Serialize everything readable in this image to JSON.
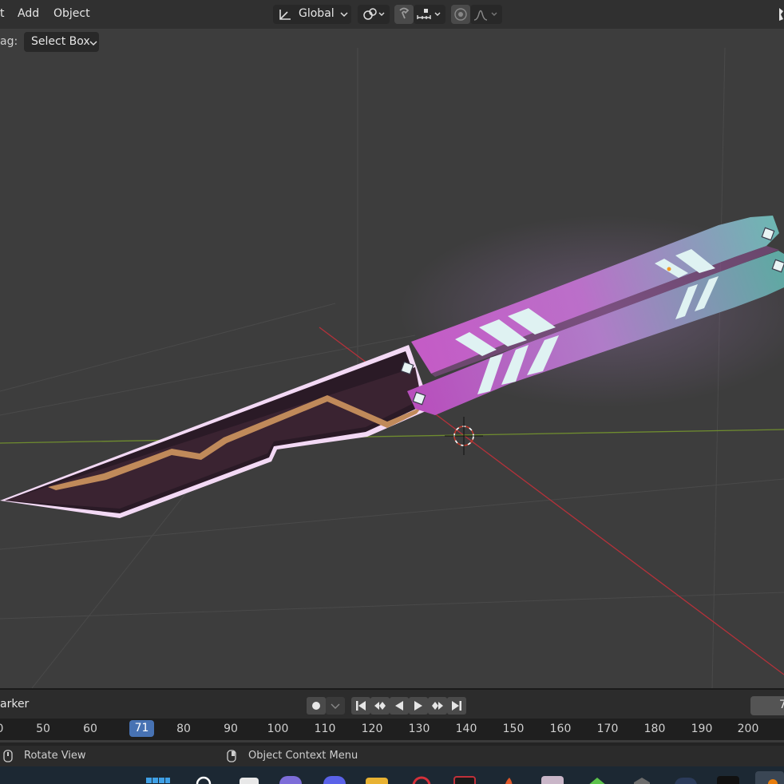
{
  "menu": {
    "select_partial": "t",
    "add": "Add",
    "object": "Object"
  },
  "toolbar": {
    "transform_orientation": "Global",
    "icons": [
      "orientation-axes-icon",
      "chevron-down-icon",
      "pivot-link-icon",
      "snap-magnet-icon",
      "snap-increment-icon",
      "proportional-edit-icon",
      "falloff-curve-icon"
    ]
  },
  "tool_options": {
    "drag_label": "ag:",
    "drag_value": "Select Box"
  },
  "timeline": {
    "marker_label": "arker",
    "current_frame": "71",
    "ticks": [
      "0",
      "50",
      "60",
      "80",
      "90",
      "100",
      "110",
      "120",
      "130",
      "140",
      "150",
      "160",
      "170",
      "180",
      "190",
      "200"
    ],
    "end_field_partial": "7"
  },
  "statusbar": {
    "left_hint": "Rotate View",
    "right_hint": "Object Context Menu"
  },
  "colors": {
    "accent_blue": "#4772b3",
    "viewport_bg": "#3d3d3d",
    "knife_magenta": "#c25cc4",
    "knife_teal": "#6fb8b0",
    "blade_glow": "#f3d9f5",
    "blade_copper": "#c08a5a",
    "axis_x_red": "#b5313a",
    "axis_y_green": "#6f8c2f"
  }
}
